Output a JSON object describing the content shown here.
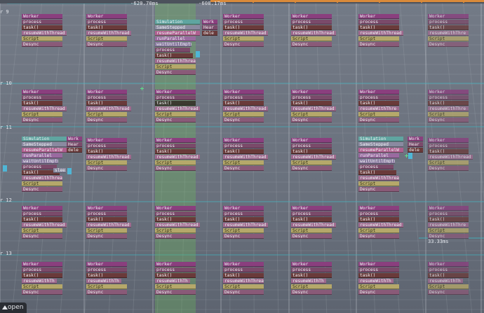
{
  "timeline": {
    "markers": [
      "-620.70ms",
      "-608.17ms"
    ],
    "frame_labels": [
      "r 9",
      "r 10",
      "r 11",
      "r 12",
      "r 13"
    ],
    "readout": "33.33ms"
  },
  "open_button": {
    "label": "open"
  },
  "block_types": {
    "w": "Worker",
    "p": "process",
    "t": "task()",
    "r": "resumeWithThread",
    "rs": "resumeWithThre",
    "rm": "resumeWithTh",
    "s": "Script",
    "d": "Desync",
    "sim": "Simulation",
    "ss": "SameStepped",
    "rp": "resumeParallelW",
    "rpl": "resumeParallelWa",
    "ru": "runParallel",
    "wu": "waitUntilEmpty",
    "wk": "Work",
    "he": "Hear",
    "de": "dele",
    "sl": "slee",
    "ts": "task()"
  },
  "colors": {
    "green_column": "#6ebe5a",
    "timeline_accent": "#d98a3a",
    "vsync_line": "#3fb4c0"
  }
}
